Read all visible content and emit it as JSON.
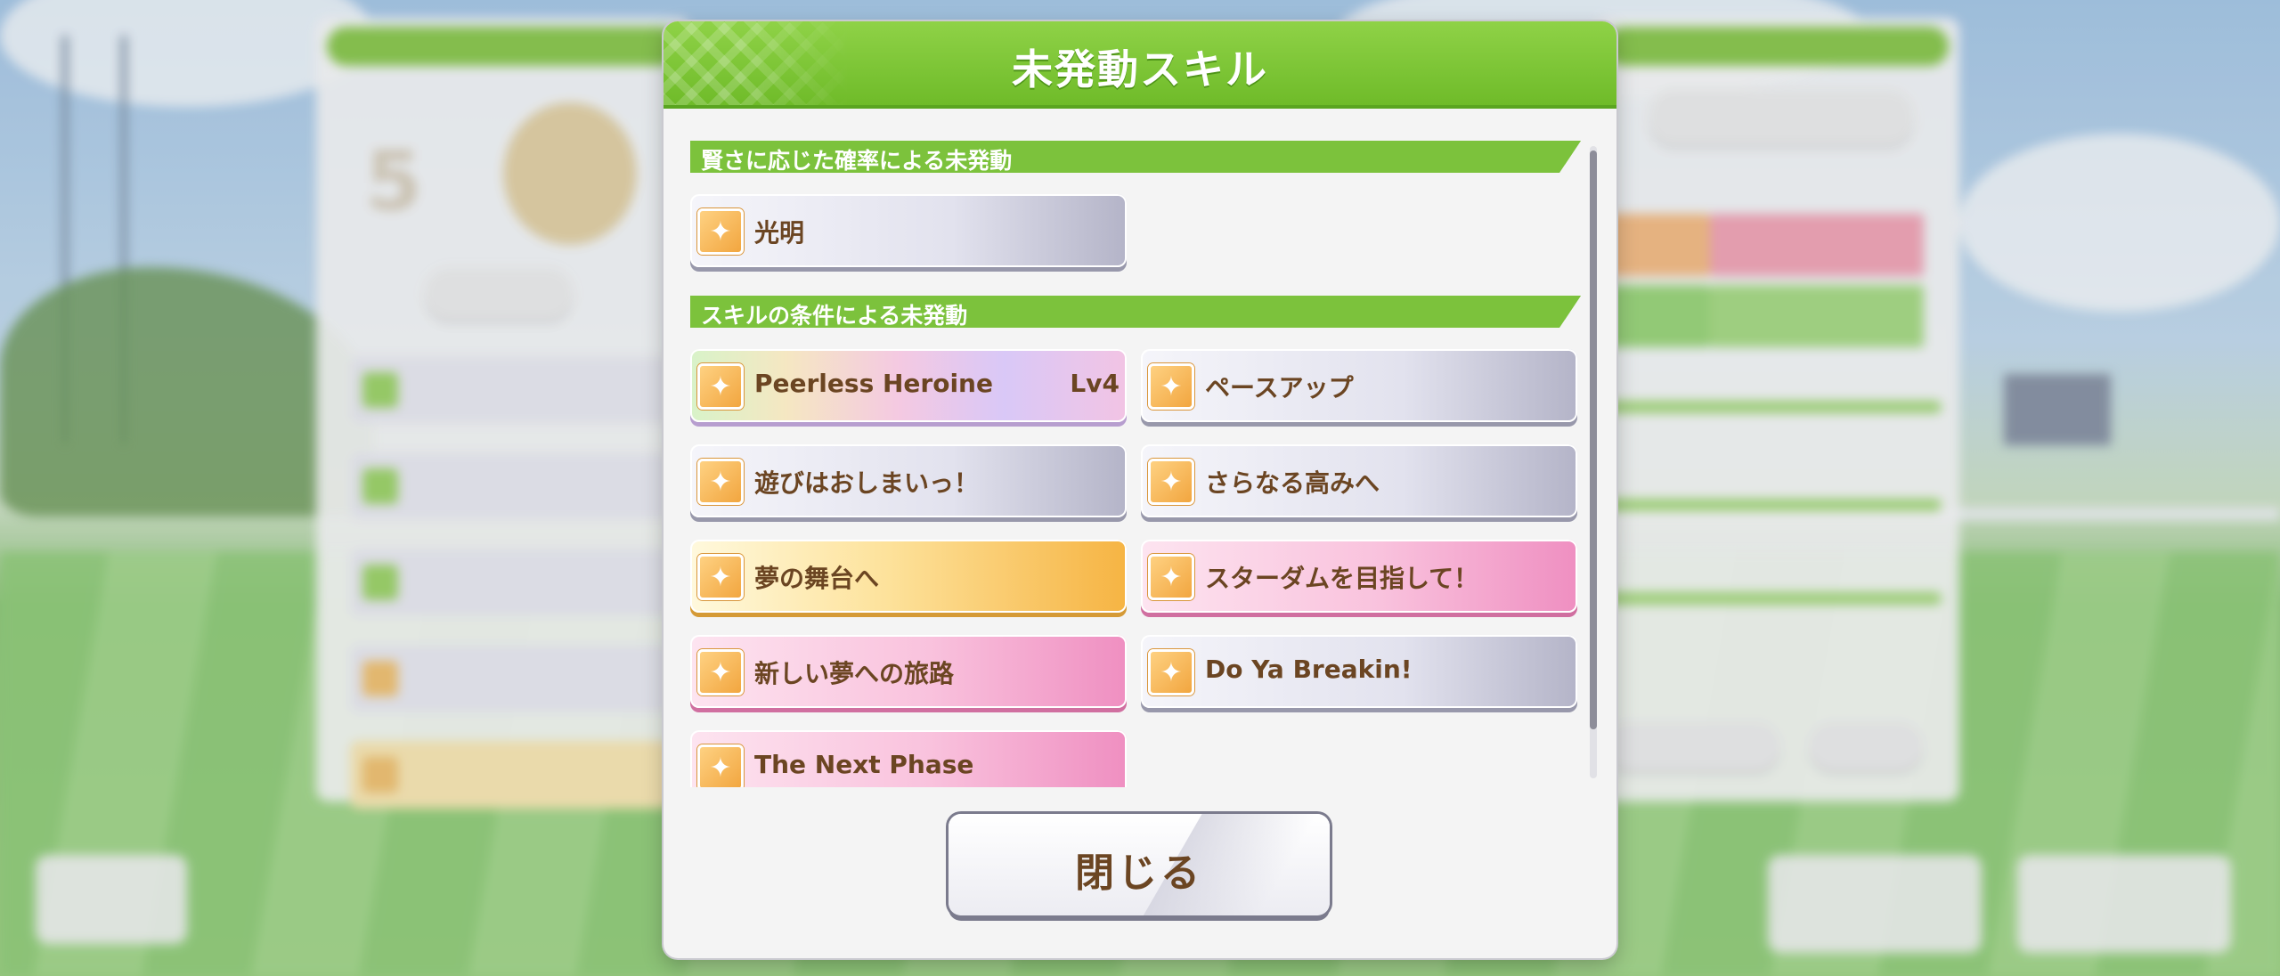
{
  "dialog": {
    "title": "未発動スキル",
    "close_label": "閉じる"
  },
  "sections": [
    {
      "label": "賢さに応じた確率による未発動",
      "skills": [
        {
          "name": "光明",
          "level": "",
          "rarity": "gray",
          "icon": "skill-icon"
        }
      ]
    },
    {
      "label": "スキルの条件による未発動",
      "skills": [
        {
          "name": "Peerless Heroine",
          "level": "Lv4",
          "rarity": "rainbow",
          "icon": "skill-icon"
        },
        {
          "name": "ペースアップ",
          "level": "",
          "rarity": "gray",
          "icon": "skill-icon"
        },
        {
          "name": "遊びはおしまいっ！",
          "level": "",
          "rarity": "gray",
          "icon": "skill-icon"
        },
        {
          "name": "さらなる高みへ",
          "level": "",
          "rarity": "gray",
          "icon": "skill-icon"
        },
        {
          "name": "夢の舞台へ",
          "level": "",
          "rarity": "gold",
          "icon": "skill-icon"
        },
        {
          "name": "スターダムを目指して！",
          "level": "",
          "rarity": "pink",
          "icon": "skill-icon"
        },
        {
          "name": "新しい夢への旅路",
          "level": "",
          "rarity": "pink",
          "icon": "skill-icon"
        },
        {
          "name": "Do Ya Breakin!",
          "level": "",
          "rarity": "gray",
          "icon": "skill-icon"
        },
        {
          "name": "The Next Phase",
          "level": "",
          "rarity": "pink",
          "icon": "skill-icon"
        }
      ]
    }
  ]
}
